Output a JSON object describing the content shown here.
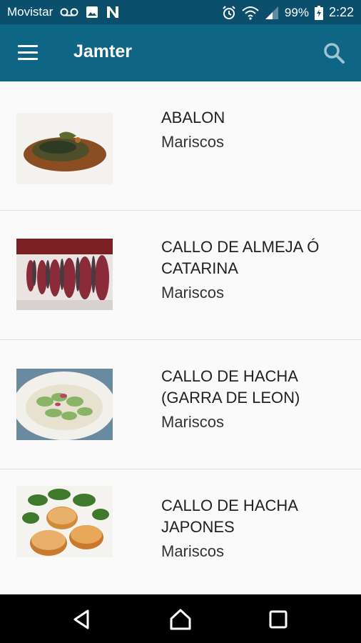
{
  "status_bar": {
    "carrier": "Movistar",
    "battery": "99%",
    "time": "2:22",
    "icons": [
      "voicemail-icon",
      "image-icon",
      "n-icon",
      "alarm-icon",
      "wifi-icon",
      "signal-icon",
      "battery-icon"
    ]
  },
  "toolbar": {
    "title": "Jamter",
    "icons": [
      "menu-icon",
      "search-icon"
    ]
  },
  "items": [
    {
      "name": "ABALON",
      "category": "Mariscos"
    },
    {
      "name": "CALLO DE ALMEJA Ó CATARINA",
      "category": "Mariscos"
    },
    {
      "name": "CALLO DE HACHA (GARRA DE LEON)",
      "category": "Mariscos"
    },
    {
      "name": "CALLO DE HACHA JAPONES",
      "category": "Mariscos"
    }
  ],
  "nav_bar": {
    "icons": [
      "back-icon",
      "home-icon",
      "recents-icon"
    ]
  },
  "colors": {
    "status_bar": "#0b4f6c",
    "toolbar": "#0e6584",
    "list_bg": "#fafafa"
  }
}
